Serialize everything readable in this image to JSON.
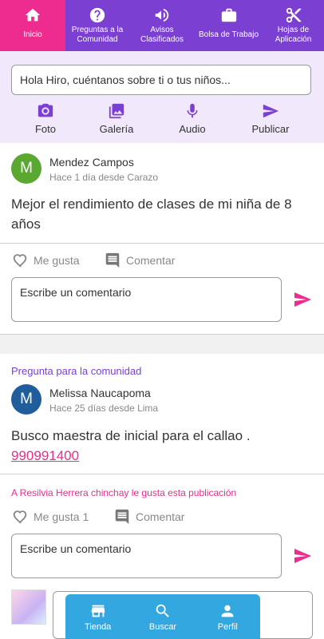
{
  "colors": {
    "purple": "#7b3fd1",
    "pink": "#ee2b8f",
    "lilac_bg": "#f1e8fb",
    "blue_nav": "#33a7df"
  },
  "topnav": {
    "tabs": [
      {
        "label": "Inicio",
        "icon": "home-icon",
        "active": true
      },
      {
        "label": "Preguntas a la Comunidad",
        "icon": "help-icon"
      },
      {
        "label": "Avisos Clasificados",
        "icon": "megaphone-icon"
      },
      {
        "label": "Bolsa de Trabajo",
        "icon": "briefcase-icon"
      },
      {
        "label": "Hojas de Aplicación",
        "icon": "scissors-icon"
      }
    ]
  },
  "composer": {
    "placeholder": "Hola Hiro, cuéntanos sobre ti o tus niños...",
    "actions": [
      {
        "label": "Foto",
        "icon": "camera-icon"
      },
      {
        "label": "Galería",
        "icon": "gallery-icon"
      },
      {
        "label": "Audio",
        "icon": "mic-icon"
      },
      {
        "label": "Publicar",
        "icon": "send-icon"
      }
    ]
  },
  "posts": [
    {
      "avatar_letter": "M",
      "avatar_color": "#5aa832",
      "author": "Mendez Campos",
      "meta": "Hace 1 día desde Carazo",
      "text": "Mejor el rendimiento de clases de mi niña de 8 años",
      "like_label": "Me gusta",
      "comment_label": "Comentar",
      "comment_placeholder": "Escribe un comentario"
    },
    {
      "category": "Pregunta para la comunidad",
      "avatar_letter": "M",
      "avatar_color": "#1f5d9c",
      "author": "Melissa Naucapoma",
      "meta": "Hace 25 días desde Lima",
      "text": "Busco maestra de inicial para el callao .",
      "phone": "990991400",
      "liked_by": "A Resilvia Herrera chinchay le gusta esta publicación",
      "like_label": "Me gusta 1",
      "comment_label": "Comentar",
      "comment_placeholder": "Escribe un comentario"
    }
  ],
  "bottomnav": {
    "items": [
      {
        "label": "Tienda",
        "icon": "store-icon"
      },
      {
        "label": "Buscar",
        "icon": "search-icon"
      },
      {
        "label": "Perfil",
        "icon": "person-icon"
      }
    ]
  }
}
